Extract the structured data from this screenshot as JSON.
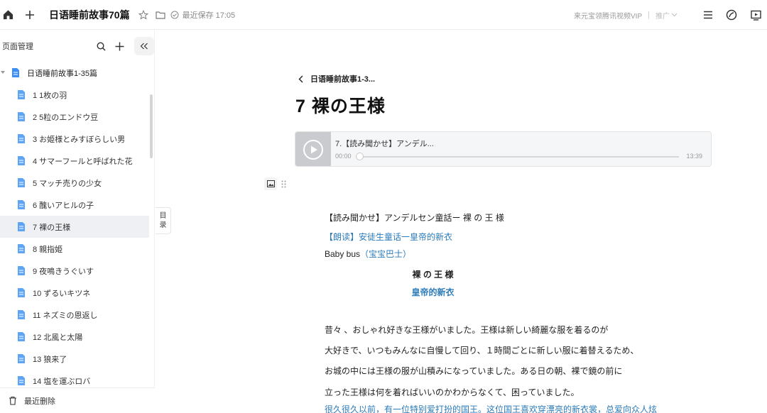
{
  "topbar": {
    "title": "日语睡前故事70篇",
    "saved": "最近保存 17:05",
    "vip": "来元宝领腾讯视频VIP",
    "sep": "|",
    "push": "推广"
  },
  "sidebar": {
    "title": "页面管理",
    "root": "日语睡前故事1-35篇",
    "items": [
      {
        "label": "1 1枚の羽"
      },
      {
        "label": "2 5粒のエンドウ豆"
      },
      {
        "label": "3 お姫様とみすぼらしい男"
      },
      {
        "label": "4 サマーフールと呼ばれた花"
      },
      {
        "label": "5 マッチ売りの少女"
      },
      {
        "label": "6 醜いアヒルの子"
      },
      {
        "label": "7 裸の王様"
      },
      {
        "label": "8 親指姫"
      },
      {
        "label": "9 夜鳴きうぐいす"
      },
      {
        "label": "10 ずるいキツネ"
      },
      {
        "label": "11 ネズミの恩返し"
      },
      {
        "label": "12 北風と太陽"
      },
      {
        "label": "13 狼来了"
      },
      {
        "label": "14 塩を運ぶロバ"
      }
    ],
    "footer": "最近删除"
  },
  "toc_tab": [
    "目",
    "录"
  ],
  "main": {
    "breadcrumb": "日语睡前故事1-3...",
    "title": "7 裸の王様",
    "audio": {
      "title": "7.【読み聞かせ】アンデル...",
      "current": "00:00",
      "total": "13:39",
      "progress": 0.0
    },
    "content": {
      "l1": "【読み聞かせ】アンデルセン童話ー 裸 の 王 様",
      "l2": "【朗读】安徒生童话一皇帝的新衣",
      "l3a": "Baby bus",
      "l3b": "（宝宝巴士）",
      "l4": "裸 の 王 様",
      "l5": "皇帝的新衣",
      "p1": "昔々 、おしゃれ好きな王様がいました。王様は新しい綺麗な服を着るのが",
      "p2": "大好きで、いつもみんなに自慢して回り、１時間ごとに新しい服に着替えるため、",
      "p3": "お城の中には王様の服が山積みになっていました。ある日の朝、裸で鏡の前に",
      "p4": "立った王様は何を着ればいいのかわからなくて、困っていました。",
      "p5": "很久很久以前，有一位特别爱打扮的国王。这位国王喜欢穿漂亮的新衣裳，总爱向众人炫"
    }
  }
}
